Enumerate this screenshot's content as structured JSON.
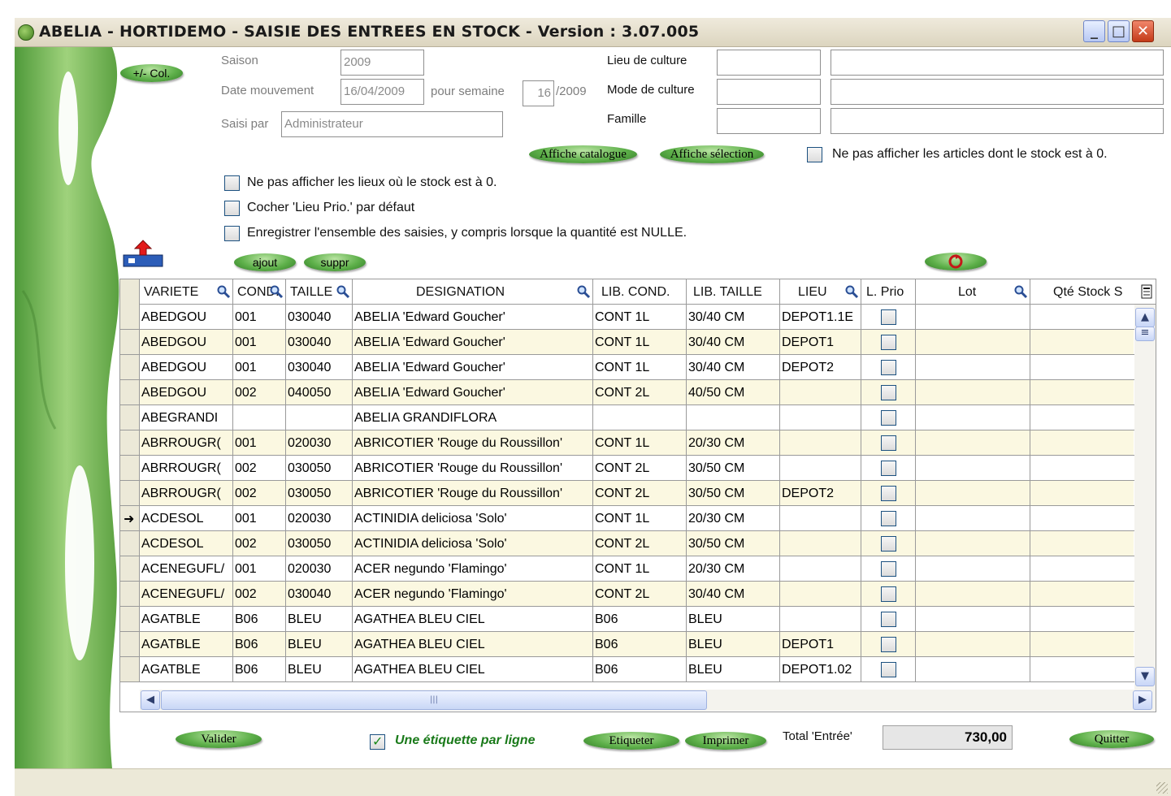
{
  "window": {
    "title": "ABELIA  -  HORTIDEMO  -  SAISIE DES ENTREES EN STOCK  -  Version : 3.07.005",
    "min_glyph": "_",
    "max_glyph": "□",
    "close_glyph": "✕"
  },
  "form": {
    "col_toggle_label": "+/- Col.",
    "saison_label": "Saison",
    "saison_value": "2009",
    "date_label": "Date mouvement",
    "date_value": "16/04/2009",
    "semaine_label": "pour semaine",
    "semaine_value": "16",
    "semaine_year": "/2009",
    "saisi_label": "Saisi par",
    "saisi_value": "Administrateur",
    "lieu_culture_label": "Lieu de culture",
    "mode_culture_label": "Mode de culture",
    "famille_label": "Famille",
    "affiche_catalogue": "Affiche catalogue",
    "affiche_selection": "Affiche sélection",
    "opt_articles_stock0": "Ne pas afficher les articles dont le stock est à 0.",
    "opt_lieux_stock0": "Ne pas afficher les lieux où le stock est à 0.",
    "opt_lieu_prio": "Cocher 'Lieu Prio.' par défaut",
    "opt_enregistrer": "Enregistrer l'ensemble des saisies, y compris lorsque la quantité est NULLE.",
    "ajout_label": "ajout",
    "suppr_label": "suppr"
  },
  "grid": {
    "columns": [
      "VARIETE",
      "CONDI",
      "TAILLE",
      "DESIGNATION",
      "LIB. COND.",
      "LIB. TAILLE",
      "LIEU",
      "L. Prio",
      "Lot",
      "Qté Stock S"
    ],
    "rows": [
      {
        "variete": "ABEDGOU",
        "cond": "001",
        "taille": "030040",
        "designation": "ABELIA 'Edward Goucher'",
        "lib_cond": "CONT 1L",
        "lib_taille": "30/40 CM",
        "lieu": "DEPOT1.1E"
      },
      {
        "variete": "ABEDGOU",
        "cond": "001",
        "taille": "030040",
        "designation": "ABELIA 'Edward Goucher'",
        "lib_cond": "CONT 1L",
        "lib_taille": "30/40 CM",
        "lieu": "DEPOT1"
      },
      {
        "variete": "ABEDGOU",
        "cond": "001",
        "taille": "030040",
        "designation": "ABELIA 'Edward Goucher'",
        "lib_cond": "CONT 1L",
        "lib_taille": "30/40 CM",
        "lieu": "DEPOT2"
      },
      {
        "variete": "ABEDGOU",
        "cond": "002",
        "taille": "040050",
        "designation": "ABELIA 'Edward Goucher'",
        "lib_cond": "CONT 2L",
        "lib_taille": "40/50 CM",
        "lieu": ""
      },
      {
        "variete": "ABEGRANDI",
        "cond": "",
        "taille": "",
        "designation": "ABELIA GRANDIFLORA",
        "lib_cond": "",
        "lib_taille": "",
        "lieu": ""
      },
      {
        "variete": "ABRROUGR(",
        "cond": "001",
        "taille": "020030",
        "designation": "ABRICOTIER 'Rouge du Roussillon'",
        "lib_cond": "CONT 1L",
        "lib_taille": "20/30 CM",
        "lieu": ""
      },
      {
        "variete": "ABRROUGR(",
        "cond": "002",
        "taille": "030050",
        "designation": "ABRICOTIER 'Rouge du Roussillon'",
        "lib_cond": "CONT 2L",
        "lib_taille": "30/50 CM",
        "lieu": ""
      },
      {
        "variete": "ABRROUGR(",
        "cond": "002",
        "taille": "030050",
        "designation": "ABRICOTIER 'Rouge du Roussillon'",
        "lib_cond": "CONT 2L",
        "lib_taille": "30/50 CM",
        "lieu": "DEPOT2"
      },
      {
        "variete": "ACDESOL",
        "cond": "001",
        "taille": "020030",
        "designation": "ACTINIDIA deliciosa 'Solo'",
        "lib_cond": "CONT 1L",
        "lib_taille": "20/30 CM",
        "lieu": ""
      },
      {
        "variete": "ACDESOL",
        "cond": "002",
        "taille": "030050",
        "designation": "ACTINIDIA deliciosa 'Solo'",
        "lib_cond": "CONT 2L",
        "lib_taille": "30/50 CM",
        "lieu": ""
      },
      {
        "variete": "ACENEGUFL/",
        "cond": "001",
        "taille": "020030",
        "designation": "ACER negundo 'Flamingo'",
        "lib_cond": "CONT 1L",
        "lib_taille": "20/30 CM",
        "lieu": ""
      },
      {
        "variete": "ACENEGUFL/",
        "cond": "002",
        "taille": "030040",
        "designation": "ACER negundo 'Flamingo'",
        "lib_cond": "CONT 2L",
        "lib_taille": "30/40 CM",
        "lieu": ""
      },
      {
        "variete": "AGATBLE",
        "cond": "B06",
        "taille": "BLEU",
        "designation": "AGATHEA BLEU CIEL",
        "lib_cond": "B06",
        "lib_taille": "BLEU",
        "lieu": ""
      },
      {
        "variete": "AGATBLE",
        "cond": "B06",
        "taille": "BLEU",
        "designation": "AGATHEA BLEU CIEL",
        "lib_cond": "B06",
        "lib_taille": "BLEU",
        "lieu": "DEPOT1"
      },
      {
        "variete": "AGATBLE",
        "cond": "B06",
        "taille": "BLEU",
        "designation": "AGATHEA BLEU CIEL",
        "lib_cond": "B06",
        "lib_taille": "BLEU",
        "lieu": "DEPOT1.02"
      }
    ],
    "current_row_marker": "➜"
  },
  "footer": {
    "valider": "Valider",
    "etiquette_par_ligne": "Une étiquette par ligne",
    "etiqueter": "Etiqueter",
    "imprimer": "Imprimer",
    "total_label": "Total 'Entrée'",
    "total_value": "730,00",
    "quitter": "Quitter"
  },
  "colors": {
    "row_alt": "#fbf8e1",
    "button_green": "#5eb04a",
    "deco_green": "#78b85a"
  }
}
